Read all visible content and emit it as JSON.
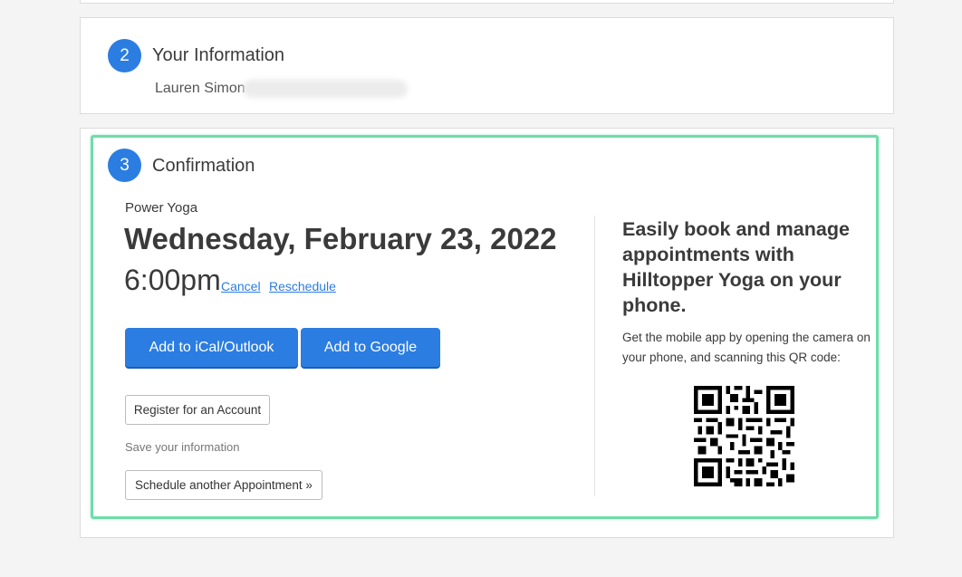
{
  "steps": {
    "info": {
      "number": "2",
      "title": "Your Information",
      "name": "Lauren Simon"
    },
    "confirmation": {
      "number": "3",
      "title": "Confirmation"
    }
  },
  "appointment": {
    "service": "Power Yoga",
    "date": "Wednesday, February 23, 2022",
    "time": "6:00pm",
    "cancel_label": "Cancel",
    "reschedule_label": "Reschedule"
  },
  "buttons": {
    "ical": "Add to iCal/Outlook",
    "google": "Add to Google",
    "register": "Register for an Account",
    "save_note": "Save your information",
    "schedule_another": "Schedule another Appointment »"
  },
  "promo": {
    "title": "Easily book and manage appointments with Hilltopper Yoga on your phone.",
    "body": "Get the mobile app by opening the camera on your phone, and scanning this QR code:"
  },
  "colors": {
    "accent": "#2b7de1",
    "highlight": "#6fdcaa"
  },
  "icons": {
    "qr": "qr-code-icon"
  }
}
